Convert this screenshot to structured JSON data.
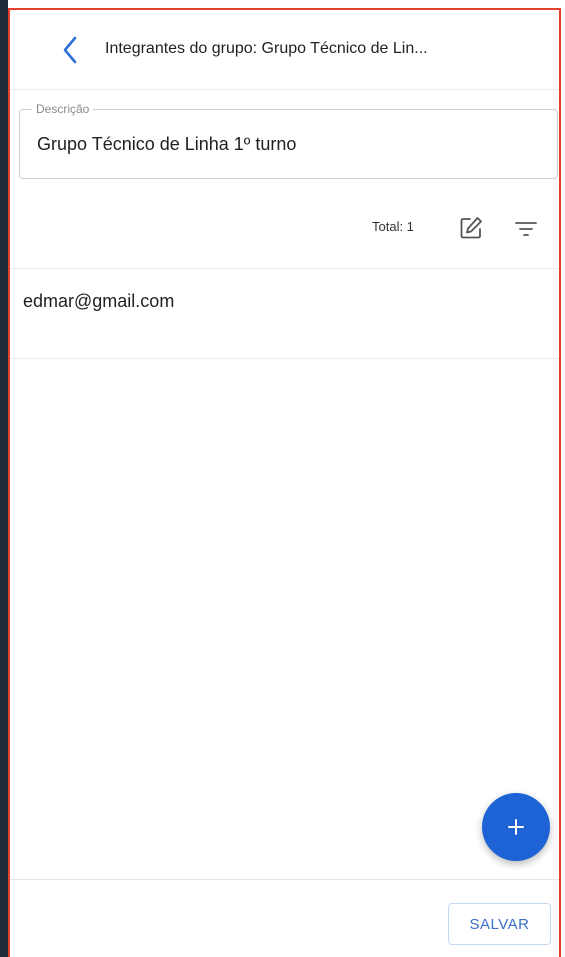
{
  "header": {
    "title": "Integrantes do grupo: Grupo Técnico de Lin...",
    "back_icon": "chevron-left-icon"
  },
  "description": {
    "label": "Descrição",
    "value": "Grupo Técnico de Linha 1º turno"
  },
  "toolbar": {
    "total_label": "Total: 1",
    "edit_icon": "edit-icon",
    "filter_icon": "filter-icon"
  },
  "members": [
    {
      "email": "edmar@gmail.com"
    }
  ],
  "fab": {
    "icon": "plus-icon"
  },
  "footer": {
    "save_label": "SALVAR"
  },
  "colors": {
    "accent": "#1e63d6",
    "frame_border": "#e8402f",
    "save_text": "#3a6fc8"
  }
}
